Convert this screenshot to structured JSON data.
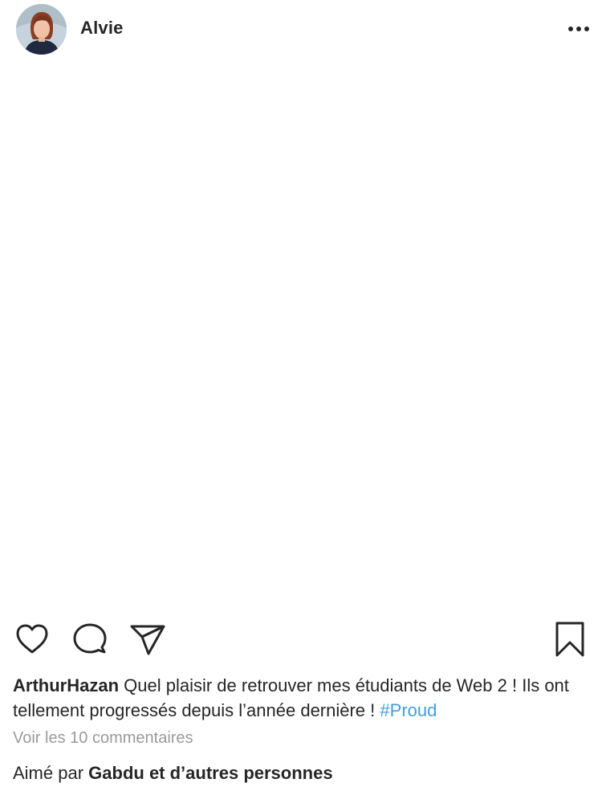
{
  "post": {
    "author": {
      "username": "Alvie",
      "avatar_icon": "avatar-portrait-icon"
    },
    "more_icon": "more-options-icon",
    "actions": {
      "like_icon": "heart-icon",
      "comment_icon": "comment-icon",
      "share_icon": "paper-plane-icon",
      "save_icon": "bookmark-icon"
    },
    "caption": {
      "author": "ArthurHazan",
      "text": "Quel plaisir de retrouver mes étudiants de Web 2 ! Ils ont tellement progressés depuis l’année dernière !",
      "hashtag": "#Proud"
    },
    "view_comments": "Voir les 10 commentaires",
    "liked_by": {
      "prefix": "Aimé par",
      "names": "Gabdu et d’autres personnes"
    }
  },
  "colors": {
    "text": "#262626",
    "muted": "#9a9a9a",
    "hashtag": "#3f9fdf",
    "background": "#ffffff"
  }
}
